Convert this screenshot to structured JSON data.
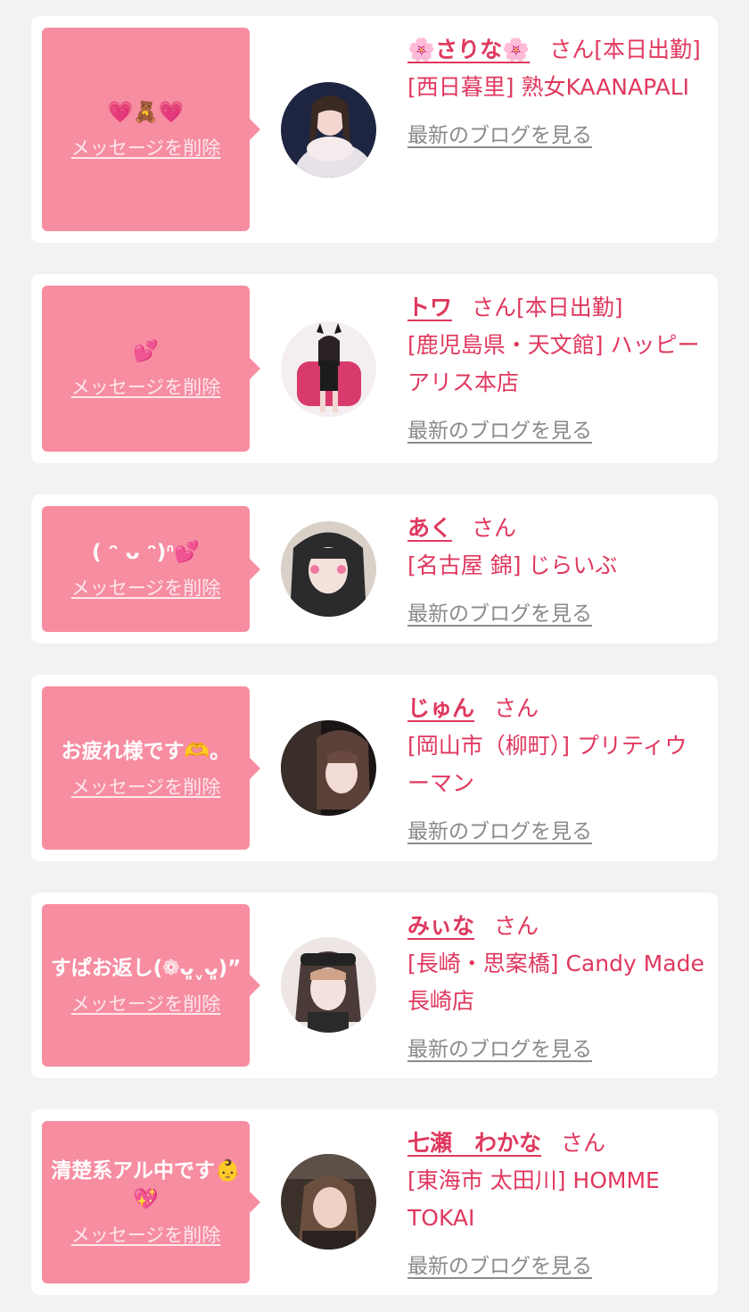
{
  "labels": {
    "delete": "メッセージを削除",
    "blog": "最新のブログを見る"
  },
  "colors": {
    "page_bg": "#f2f2f2",
    "card_bg": "#ffffff",
    "bubble": "#f78da1",
    "accent": "#e0385e",
    "muted": "#8a8a8a"
  },
  "entries": [
    {
      "message": "💗🧸💗",
      "name": "🌸さりな🌸",
      "honorific": "さん",
      "status": "[本日出勤]",
      "shop": "[西日暮里] 熟女KAANAPALI"
    },
    {
      "message": "💕",
      "name": "トワ",
      "honorific": "さん",
      "status": "[本日出勤]",
      "shop": "[鹿児島県・天文館] ハッピーアリス本店"
    },
    {
      "message": "( ᵔ ᴗ ᵔ)ᐢ💕",
      "name": "あく",
      "honorific": "さん",
      "status": "",
      "shop": "[名古屋 錦] じらいぶ"
    },
    {
      "message": "お疲れ様です🫶。",
      "name": "じゅん",
      "honorific": "さん",
      "status": "",
      "shop": "[岡山市（柳町）] プリティウーマン"
    },
    {
      "message": "すぱお返し(❁ᴗ͈ˬᴗ͈)”",
      "name": "みぃな",
      "honorific": "さん",
      "status": "",
      "shop": "[長崎・思案橋] Candy Made 長崎店"
    },
    {
      "message": "清楚系アル中です👶💖",
      "name": "七瀬　わかな",
      "honorific": "さん",
      "status": "",
      "shop": "[東海市 太田川] HOMME TOKAI"
    }
  ]
}
